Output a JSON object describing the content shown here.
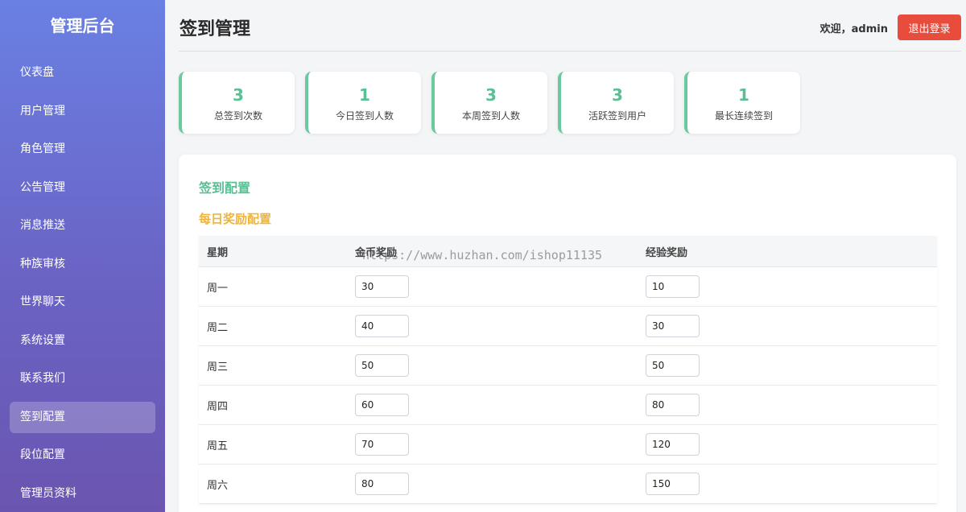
{
  "sidebar": {
    "brand": "管理后台",
    "items": [
      {
        "label": "仪表盘"
      },
      {
        "label": "用户管理"
      },
      {
        "label": "角色管理"
      },
      {
        "label": "公告管理"
      },
      {
        "label": "消息推送"
      },
      {
        "label": "种族审核"
      },
      {
        "label": "世界聊天"
      },
      {
        "label": "系统设置"
      },
      {
        "label": "联系我们"
      },
      {
        "label": "签到配置",
        "active": true
      },
      {
        "label": "段位配置"
      },
      {
        "label": "管理员资料"
      }
    ]
  },
  "header": {
    "title": "签到管理",
    "welcome": "欢迎，admin",
    "logout_label": "退出登录"
  },
  "stats": [
    {
      "value": "3",
      "label": "总签到次数"
    },
    {
      "value": "1",
      "label": "今日签到人数"
    },
    {
      "value": "3",
      "label": "本周签到人数"
    },
    {
      "value": "3",
      "label": "活跃签到用户"
    },
    {
      "value": "1",
      "label": "最长连续签到"
    }
  ],
  "config": {
    "title": "签到配置",
    "daily_title": "每日奖励配置",
    "columns": [
      "星期",
      "金币奖励",
      "经验奖励"
    ],
    "rows": [
      {
        "day": "周一",
        "coins": "30",
        "exp": "10"
      },
      {
        "day": "周二",
        "coins": "40",
        "exp": "30"
      },
      {
        "day": "周三",
        "coins": "50",
        "exp": "50"
      },
      {
        "day": "周四",
        "coins": "60",
        "exp": "80"
      },
      {
        "day": "周五",
        "coins": "70",
        "exp": "120"
      },
      {
        "day": "周六",
        "coins": "80",
        "exp": "150"
      }
    ]
  },
  "watermark": "https://www.huzhan.com/ishop11135",
  "colors": {
    "accent_green": "#5bbf94",
    "accent_orange": "#f0b43c",
    "danger": "#e74c3c"
  }
}
